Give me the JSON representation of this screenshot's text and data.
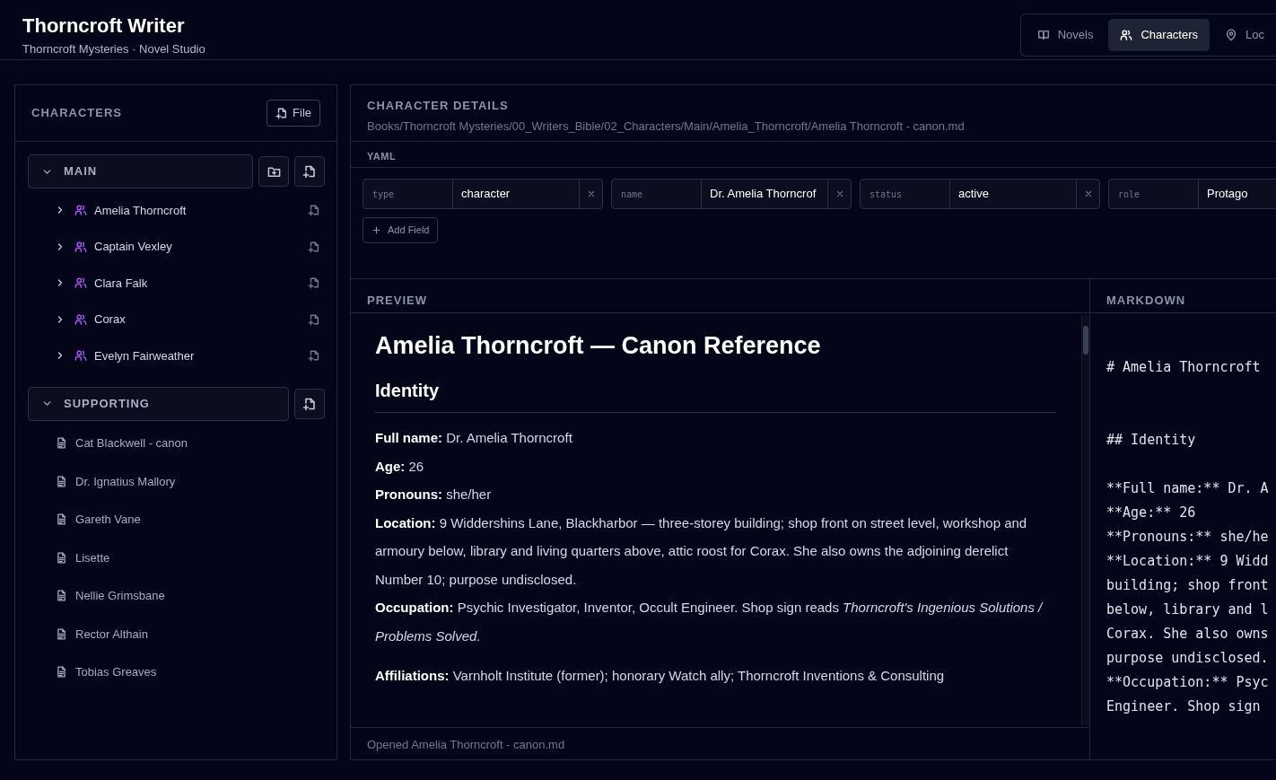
{
  "app": {
    "title": "Thorncroft Writer",
    "subtitle": "Thorncroft Mysteries · Novel Studio"
  },
  "nav_tabs": [
    {
      "label": "Novels",
      "selected": false
    },
    {
      "label": "Characters",
      "selected": true
    },
    {
      "label": "Loc",
      "selected": false
    }
  ],
  "sidebar": {
    "title": "CHARACTERS",
    "file_button": "File",
    "groups": [
      {
        "label": "MAIN",
        "expanded": true,
        "can_add_folder": true,
        "items": [
          {
            "label": "Amelia Thorncroft",
            "kind": "character"
          },
          {
            "label": "Captain Vexley",
            "kind": "character"
          },
          {
            "label": "Clara Falk",
            "kind": "character"
          },
          {
            "label": "Corax",
            "kind": "character"
          },
          {
            "label": "Evelyn Fairweather",
            "kind": "character"
          }
        ]
      },
      {
        "label": "SUPPORTING",
        "expanded": true,
        "can_add_folder": false,
        "items": [
          {
            "label": "Cat Blackwell - canon",
            "kind": "file"
          },
          {
            "label": "Dr. Ignatius Mallory",
            "kind": "file"
          },
          {
            "label": "Gareth Vane",
            "kind": "file"
          },
          {
            "label": "Lisette",
            "kind": "file"
          },
          {
            "label": "Nellie Grimsbane",
            "kind": "file"
          },
          {
            "label": "Rector Althain",
            "kind": "file"
          },
          {
            "label": "Tobias Greaves",
            "kind": "file"
          }
        ]
      }
    ]
  },
  "details": {
    "title": "CHARACTER DETAILS",
    "path": "Books/Thorncroft Mysteries/00_Writers_Bible/02_Characters/Main/Amelia_Thorncroft/Amelia Thorncroft - canon.md"
  },
  "yaml": {
    "label": "YAML",
    "fields": [
      {
        "key": "type",
        "value": "character",
        "removable": true
      },
      {
        "key": "name",
        "value": "Dr. Amelia Thorncrof",
        "removable": true
      },
      {
        "key": "status",
        "value": "active",
        "removable": true
      },
      {
        "key": "role",
        "value": "Protago",
        "removable": false
      }
    ],
    "add_button": "Add Field"
  },
  "preview": {
    "label": "PREVIEW",
    "blocks": [
      {
        "kind": "title",
        "text": "Amelia Thorncroft — Canon Reference"
      },
      {
        "kind": "heading",
        "text": "Identity"
      },
      {
        "kind": "field",
        "text": "**Full name:** Dr. Amelia Thorncroft"
      },
      {
        "kind": "field",
        "text": "**Age:** 26"
      },
      {
        "kind": "field",
        "text": "**Pronouns:** she/her"
      },
      {
        "kind": "field",
        "text": "**Location:** 9 Widdershins Lane, Blackharbor — three-storey building; shop front on street level, workshop and armoury below, library and living quarters above, attic roost for Corax. She also owns the adjoining derelict Number 10; purpose undisclosed."
      },
      {
        "kind": "field",
        "text": "**Occupation:** Psychic Investigator, Inventor, Occult Engineer. Shop sign reads *Thorncroft's Ingenious Solutions / Problems Solved.*"
      },
      {
        "kind": "paragraph",
        "text": "**Affiliations:** Varnholt Institute (former); honorary Watch ally; Thorncroft Inventions & Consulting"
      }
    ]
  },
  "markdown": {
    "label": "MARKDOWN",
    "lines": [
      {
        "kind": "h1",
        "text": "# Amelia Thorncroft"
      },
      {
        "kind": "h2",
        "text": "## Identity"
      },
      {
        "kind": "line",
        "text": "**Full name:** Dr. A"
      },
      {
        "kind": "line",
        "text": "**Age:** 26"
      },
      {
        "kind": "line",
        "text": "**Pronouns:** she/he"
      },
      {
        "kind": "line",
        "text": "**Location:** 9 Widd"
      },
      {
        "kind": "line",
        "text": "building; shop front"
      },
      {
        "kind": "line",
        "text": "below, library and l"
      },
      {
        "kind": "line",
        "text": "Corax. She also owns"
      },
      {
        "kind": "line",
        "text": "purpose undisclosed."
      },
      {
        "kind": "line",
        "text": "**Occupation:** Psyc"
      },
      {
        "kind": "line",
        "text": "Engineer. Shop sign"
      }
    ]
  },
  "status_bar": "Opened Amelia Thorncroft - canon.md"
}
